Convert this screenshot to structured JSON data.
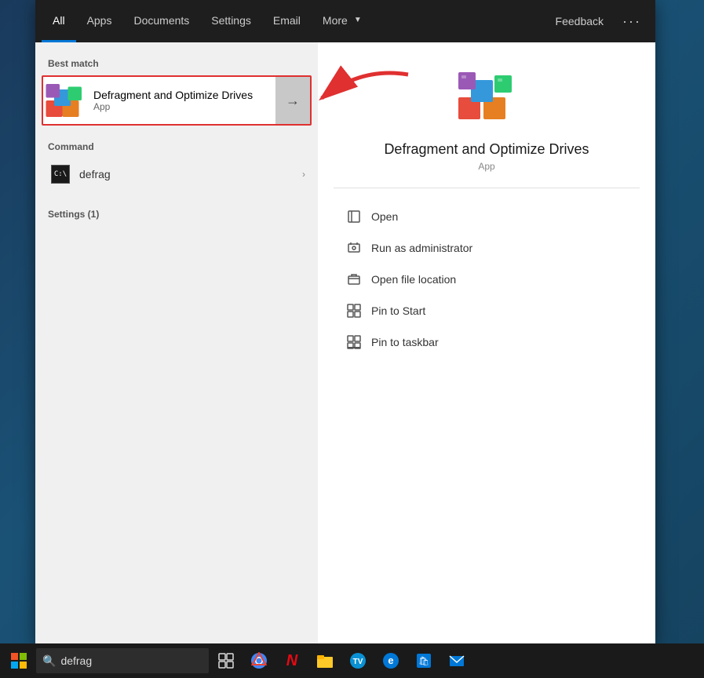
{
  "nav": {
    "items": [
      {
        "id": "all",
        "label": "All",
        "active": true
      },
      {
        "id": "apps",
        "label": "Apps"
      },
      {
        "id": "documents",
        "label": "Documents"
      },
      {
        "id": "settings",
        "label": "Settings"
      },
      {
        "id": "email",
        "label": "Email"
      },
      {
        "id": "more",
        "label": "More"
      }
    ],
    "feedback_label": "Feedback",
    "more_dots": "···"
  },
  "left_panel": {
    "best_match_label": "Best match",
    "best_match_item": {
      "title": "Defragment and Optimize Drives",
      "subtitle": "App"
    },
    "command_label": "Command",
    "command_item": {
      "title": "defrag",
      "has_submenu": true
    },
    "settings_label": "Settings (1)"
  },
  "right_panel": {
    "app_name": "Defragment and Optimize Drives",
    "app_type": "App",
    "actions": [
      {
        "id": "open",
        "label": "Open"
      },
      {
        "id": "run-admin",
        "label": "Run as administrator"
      },
      {
        "id": "open-location",
        "label": "Open file location"
      },
      {
        "id": "pin-start",
        "label": "Pin to Start"
      },
      {
        "id": "pin-taskbar",
        "label": "Pin to taskbar"
      }
    ]
  },
  "taskbar": {
    "search_text": "defrag",
    "search_placeholder": "Search"
  }
}
